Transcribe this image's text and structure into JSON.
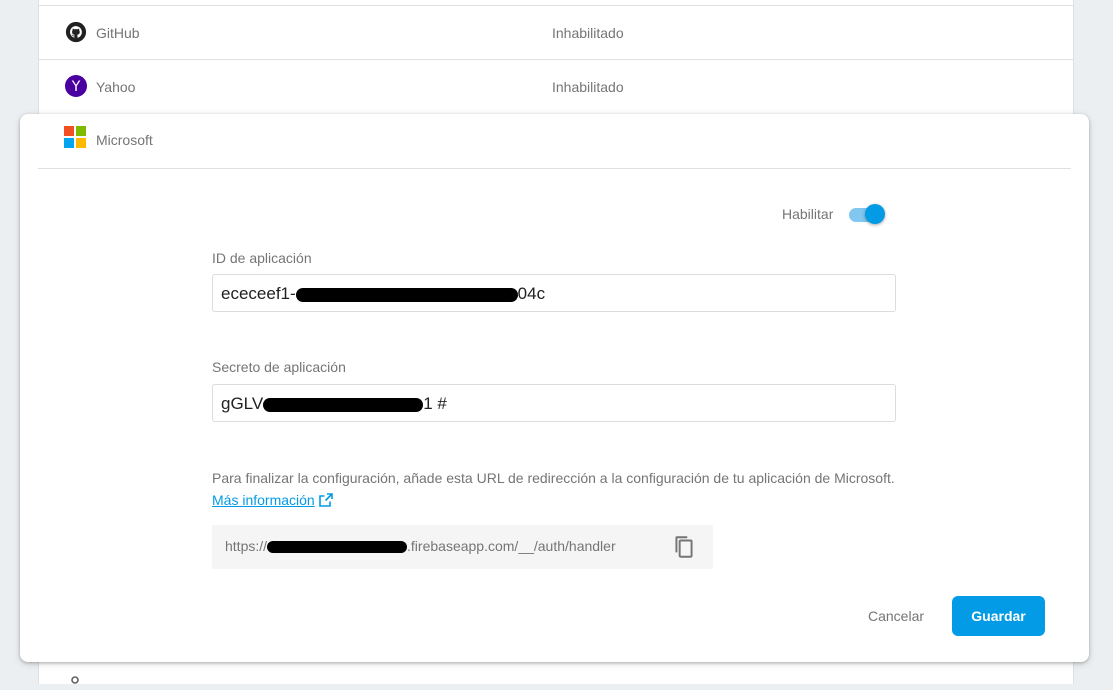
{
  "providers": [
    {
      "name": "GitHub",
      "status": "Inhabilitado",
      "icon": "github-icon"
    },
    {
      "name": "Yahoo",
      "status": "Inhabilitado",
      "icon": "yahoo-icon"
    }
  ],
  "dialog": {
    "title": "Microsoft",
    "icon": "microsoft-logo",
    "enable_label": "Habilitar",
    "enabled": true,
    "app_id": {
      "label": "ID de aplicación",
      "value_visible_start": "ececeef1-",
      "value_visible_end": "04c"
    },
    "app_secret": {
      "label": "Secreto de aplicación",
      "value_visible_start": "gGLV",
      "value_visible_end": "1 #"
    },
    "info_text": "Para finalizar la configuración, añade esta URL de redirección a la configuración de tu aplicación de Microsoft.",
    "info_link": "Más información",
    "redirect_url": {
      "prefix": "https://",
      "suffix": ".firebaseapp.com/__/auth/handler"
    },
    "cancel_label": "Cancelar",
    "save_label": "Guardar"
  },
  "colors": {
    "accent": "#039be5",
    "switch_track": "#81c7f0",
    "yahoo": "#4a00a0",
    "ms_red": "#f25022",
    "ms_green": "#7fba00",
    "ms_blue": "#00a4ef",
    "ms_yellow": "#ffb900"
  }
}
